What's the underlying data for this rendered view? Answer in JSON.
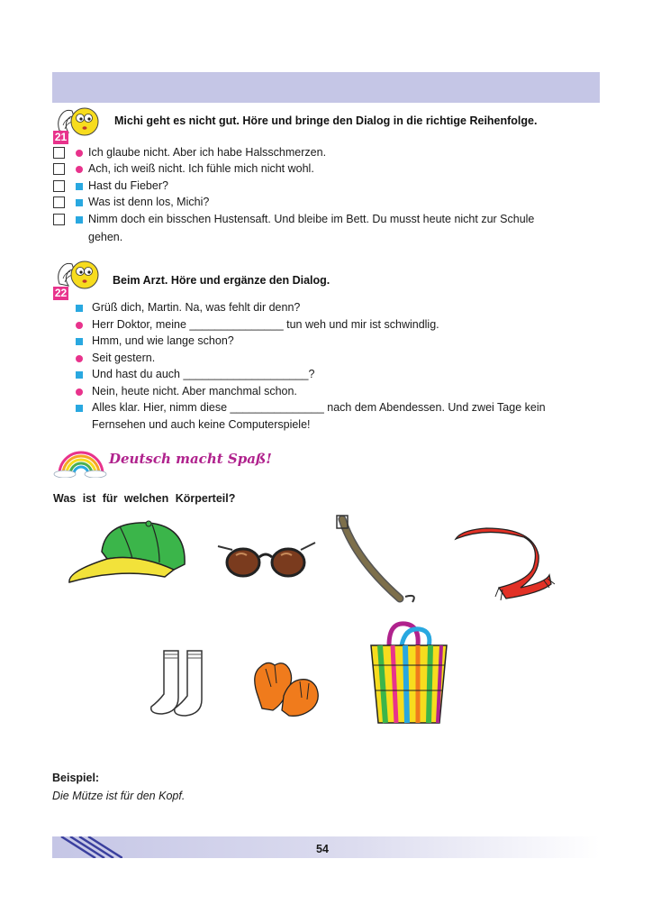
{
  "exercise21": {
    "number": "21",
    "instruction": "Michi geht es nicht gut. Höre und bringe den Dialog in die richtige Reihenfolge.",
    "lines": [
      {
        "marker": "circle",
        "text": "Ich glaube nicht. Aber ich habe Halsschmerzen."
      },
      {
        "marker": "circle",
        "text": "Ach, ich weiß nicht. Ich fühle mich nicht wohl."
      },
      {
        "marker": "square",
        "text": "Hast du Fieber?"
      },
      {
        "marker": "square",
        "text": "Was ist denn los, Michi?"
      },
      {
        "marker": "square",
        "text": "Nimm doch ein bisschen Hustensaft. Und bleibe im Bett. Du musst heute nicht zur Schule",
        "continuation": "gehen."
      }
    ]
  },
  "exercise22": {
    "number": "22",
    "instruction": "Beim Arzt. Höre und ergänze den Dialog.",
    "lines": [
      {
        "marker": "square",
        "text": "Grüß dich, Martin. Na, was fehlt dir denn?"
      },
      {
        "marker": "circle",
        "text": "Herr Doktor, meine _______________ tun weh und mir ist schwindlig."
      },
      {
        "marker": "square",
        "text": "Hmm, und wie lange schon?"
      },
      {
        "marker": "circle",
        "text": "Seit gestern."
      },
      {
        "marker": "square",
        "text": "Und hast du auch ____________________?"
      },
      {
        "marker": "circle",
        "text": "Nein, heute nicht. Aber manchmal schon."
      },
      {
        "marker": "square",
        "text": "Alles klar. Hier, nimm diese _______________ nach dem Abendessen. Und zwei Tage kein",
        "continuation": "Fernsehen und auch keine Computerspiele!"
      }
    ]
  },
  "fun_section": {
    "title": "Deutsch macht Spaß!",
    "question": "Was ist für welchen Körperteil?"
  },
  "example": {
    "label": "Beispiel:",
    "text": "Die Mütze ist für den Kopf."
  },
  "page_number": "54",
  "colors": {
    "band": "#c5c6e6",
    "pink": "#e8338c",
    "blue": "#29a8e0",
    "title": "#b0228d"
  }
}
